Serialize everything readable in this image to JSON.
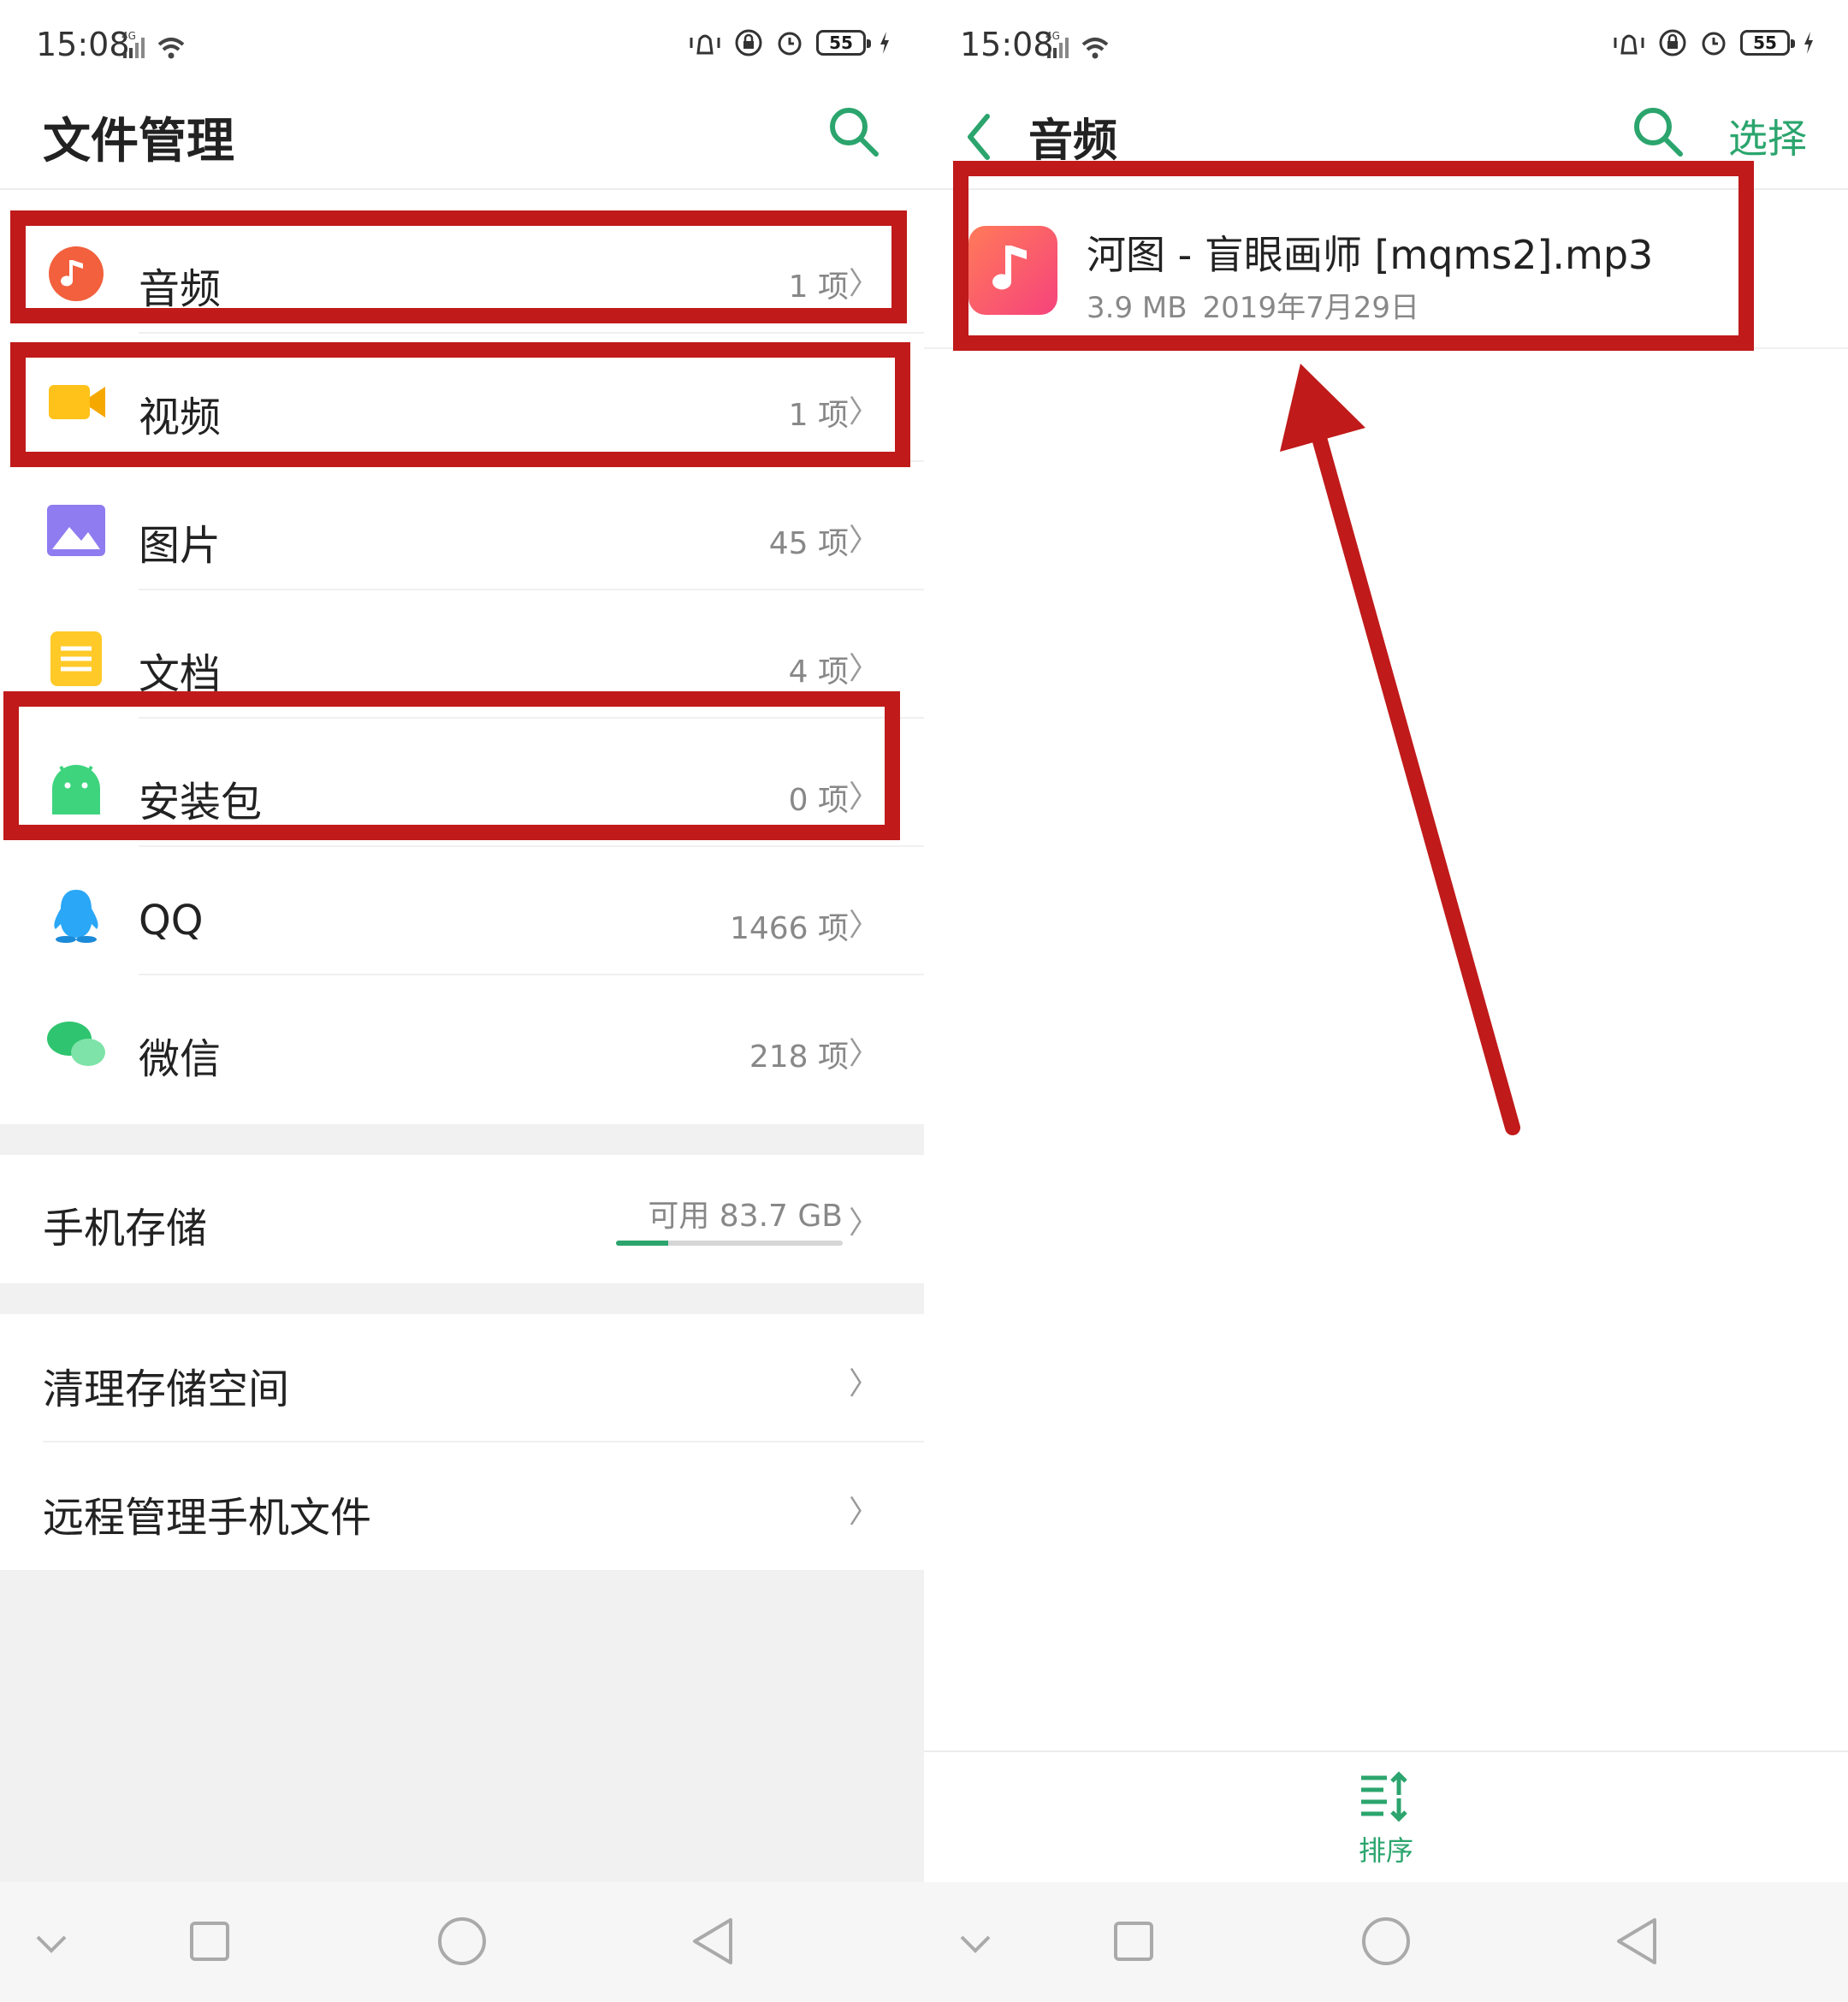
{
  "status_bar": {
    "time": "15:08",
    "network": "4G",
    "battery": "55"
  },
  "left": {
    "title": "文件管理",
    "categories": [
      {
        "label": "音频",
        "count": "1 项"
      },
      {
        "label": "视频",
        "count": "1 项"
      },
      {
        "label": "图片",
        "count": "45 项"
      },
      {
        "label": "文档",
        "count": "4 项"
      },
      {
        "label": "安装包",
        "count": "0 项"
      },
      {
        "label": "QQ",
        "count": "1466 项"
      },
      {
        "label": "微信",
        "count": "218 项"
      }
    ],
    "storage": {
      "label": "手机存储",
      "free": "可用 83.7 GB",
      "used_fraction": 0.23
    },
    "actions": [
      {
        "label": "清理存储空间"
      },
      {
        "label": "远程管理手机文件"
      }
    ]
  },
  "right": {
    "title": "音频",
    "select_label": "选择",
    "file": {
      "name": "河图 - 盲眼画师 [mqms2].mp3",
      "size": "3.9 MB",
      "date": "2019年7月29日"
    },
    "sort_label": "排序"
  },
  "colors": {
    "accent": "#2ba56d",
    "annotation": "#c01a1a"
  },
  "icons": [
    "music-icon",
    "video-icon",
    "image-icon",
    "document-icon",
    "android-icon",
    "qq-icon",
    "wechat-icon",
    "search-icon",
    "back-icon",
    "sort-icon"
  ]
}
